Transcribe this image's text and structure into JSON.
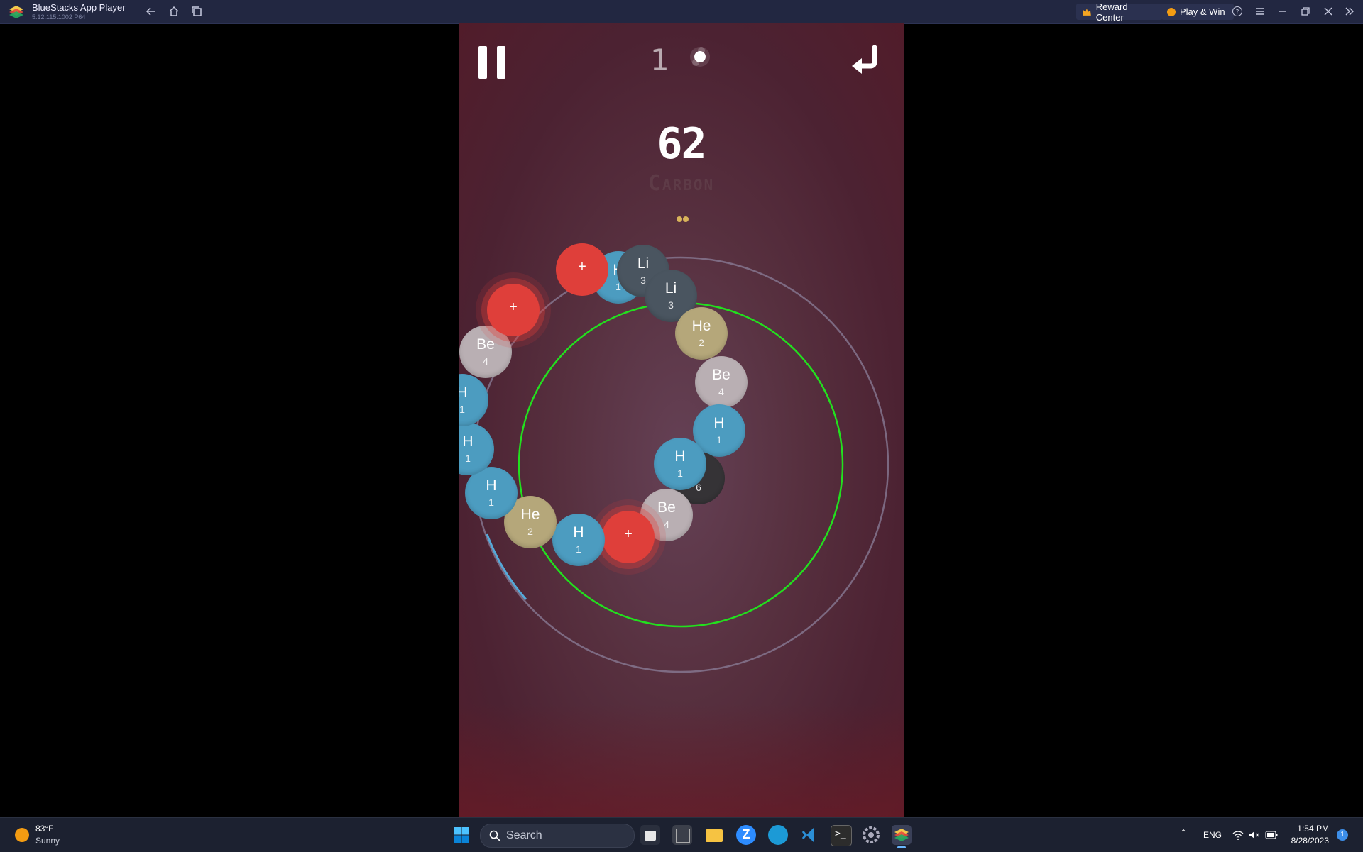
{
  "titlebar": {
    "app_title": "BlueStacks App Player",
    "version": "5.12.115.1002 P64",
    "reward_center": "Reward Center",
    "play_win": "Play & Win",
    "icons": [
      "back-icon",
      "home-icon",
      "multitask-icon",
      "help-icon",
      "menu-icon",
      "minimize-icon",
      "restore-icon",
      "close-icon",
      "collapse-sidebar-icon"
    ]
  },
  "game": {
    "undo_count": "1",
    "score": "62",
    "element_name": "Carbon",
    "center_atom": {
      "symbol": "H",
      "number": "1"
    },
    "ring_atoms": [
      {
        "kind": "atom",
        "symbol": "H",
        "number": "1"
      },
      {
        "kind": "plus",
        "symbol": "+"
      },
      {
        "kind": "atom",
        "symbol": "Li",
        "number": "3"
      },
      {
        "kind": "atom",
        "symbol": "Li",
        "number": "3"
      },
      {
        "kind": "atom",
        "symbol": "He",
        "number": "2"
      },
      {
        "kind": "atom",
        "symbol": "Be",
        "number": "4"
      },
      {
        "kind": "atom",
        "symbol": "H",
        "number": "1"
      },
      {
        "kind": "atom",
        "symbol": "C",
        "number": "6"
      },
      {
        "kind": "atom",
        "symbol": "Be",
        "number": "4"
      },
      {
        "kind": "plus",
        "symbol": "+"
      },
      {
        "kind": "atom",
        "symbol": "H",
        "number": "1"
      },
      {
        "kind": "atom",
        "symbol": "He",
        "number": "2"
      },
      {
        "kind": "atom",
        "symbol": "H",
        "number": "1"
      },
      {
        "kind": "atom",
        "symbol": "H",
        "number": "1"
      },
      {
        "kind": "atom",
        "symbol": "H",
        "number": "1"
      },
      {
        "kind": "atom",
        "symbol": "Be",
        "number": "4"
      },
      {
        "kind": "plus",
        "symbol": "+"
      }
    ],
    "colors": {
      "H": "#4c9cc0",
      "Li": "#4a5560",
      "He": "#b5a77a",
      "Be": "#b9afb3",
      "C": "#353336",
      "plus": "#df3f3a",
      "ring_highlight": "#22e01e"
    }
  },
  "taskbar": {
    "weather_temp": "83°F",
    "weather_desc": "Sunny",
    "search_placeholder": "Search",
    "language": "ENG",
    "time": "1:54 PM",
    "date": "8/28/2023",
    "notification_count": "1",
    "icons": [
      "windows-start-icon",
      "search-icon",
      "file-explorer-dark-icon",
      "terminal-app-icon",
      "folder-icon",
      "zoom-icon",
      "edge-icon",
      "vscode-icon",
      "cmd-icon",
      "settings-icon",
      "bluestacks-icon",
      "chevron-up-icon",
      "wifi-icon",
      "volume-muted-icon",
      "battery-icon"
    ]
  }
}
